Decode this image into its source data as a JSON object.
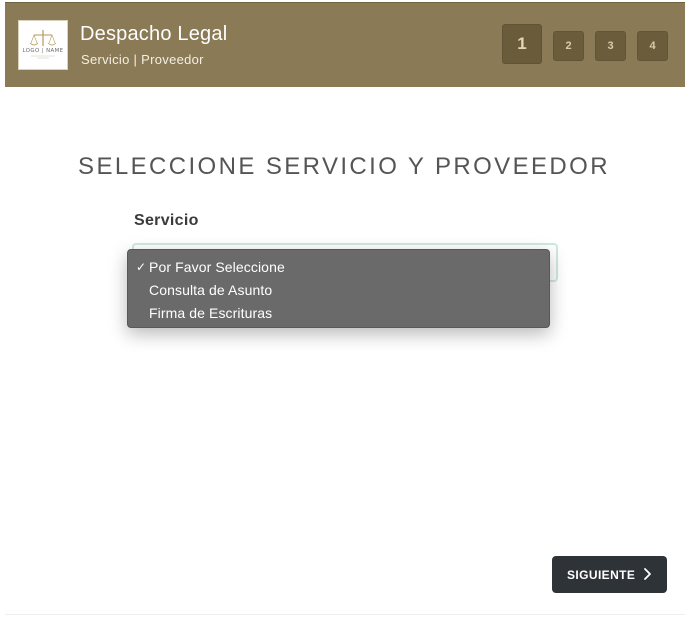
{
  "header": {
    "logo_alt": "LOGO NAME",
    "title": "Despacho Legal",
    "subtitle": "Servicio | Proveedor",
    "steps": [
      {
        "label": "1",
        "active": true
      },
      {
        "label": "2",
        "active": false
      },
      {
        "label": "3",
        "active": false
      },
      {
        "label": "4",
        "active": false
      }
    ],
    "color": "#8a7a55"
  },
  "main": {
    "title": "SELECCIONE SERVICIO Y PROVEEDOR",
    "service_label": "Servicio",
    "service_select": {
      "selected": "Por Favor Seleccione",
      "options": [
        {
          "label": "Por Favor Seleccione",
          "checked": true,
          "check_glyph": "✓"
        },
        {
          "label": "Consulta de Asunto",
          "checked": false
        },
        {
          "label": "Firma de Escrituras",
          "checked": false
        }
      ]
    }
  },
  "footer": {
    "next_label": "SIGUIENTE",
    "next_icon": "chevron-right-icon"
  }
}
